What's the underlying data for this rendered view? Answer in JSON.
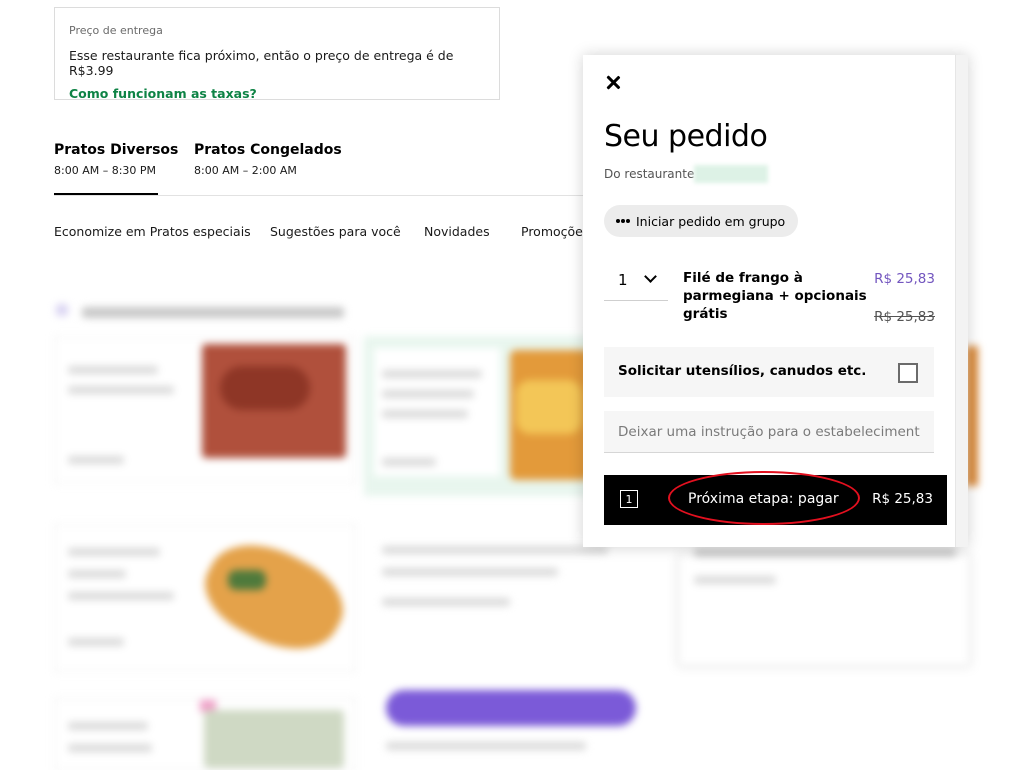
{
  "delivery": {
    "label": "Preço de entrega",
    "text": "Esse restaurante fica próximo, então o preço de entrega é de R$3.99",
    "link": "Como funcionam as taxas?"
  },
  "menus": [
    {
      "name": "Pratos Diversos",
      "hours": "8:00 AM – 8:30 PM"
    },
    {
      "name": "Pratos Congelados",
      "hours": "8:00 AM – 2:00 AM"
    }
  ],
  "categories": [
    "Economize em Pratos especiais",
    "Sugestões para você",
    "Novidades",
    "Promoções"
  ],
  "order": {
    "title": "Seu pedido",
    "from_label": "Do restaurante",
    "group_button": "Iniciar pedido em grupo",
    "item": {
      "quantity": "1",
      "name": "Filé de frango à parmegiana + opcionais grátis",
      "price": "R$ 25,83",
      "original_price": "R$ 25,83"
    },
    "utensils_label": "Solicitar utensílios, canudos etc.",
    "instruction_placeholder": "Deixar uma instrução para o estabelecimento",
    "checkout": {
      "count": "1",
      "label": "Próxima etapa: pagar",
      "price": "R$ 25,83"
    }
  },
  "colors": {
    "accent_green": "#0e8345",
    "price_purple": "#7356bf",
    "highlight_red": "#e3101f"
  },
  "icons": [
    "close-icon",
    "group-icon",
    "chevron-down-icon",
    "checkbox-icon"
  ]
}
